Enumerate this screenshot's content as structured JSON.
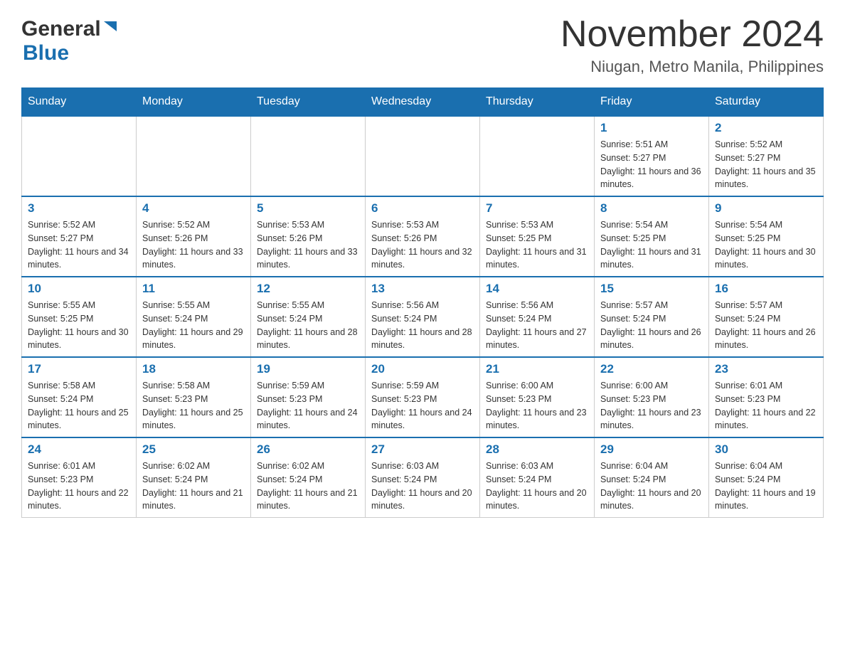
{
  "header": {
    "logo_general": "General",
    "logo_blue": "Blue",
    "month_title": "November 2024",
    "location": "Niugan, Metro Manila, Philippines"
  },
  "days_of_week": [
    "Sunday",
    "Monday",
    "Tuesday",
    "Wednesday",
    "Thursday",
    "Friday",
    "Saturday"
  ],
  "weeks": [
    {
      "days": [
        {
          "date": "",
          "info": ""
        },
        {
          "date": "",
          "info": ""
        },
        {
          "date": "",
          "info": ""
        },
        {
          "date": "",
          "info": ""
        },
        {
          "date": "",
          "info": ""
        },
        {
          "date": "1",
          "info": "Sunrise: 5:51 AM\nSunset: 5:27 PM\nDaylight: 11 hours and 36 minutes."
        },
        {
          "date": "2",
          "info": "Sunrise: 5:52 AM\nSunset: 5:27 PM\nDaylight: 11 hours and 35 minutes."
        }
      ]
    },
    {
      "days": [
        {
          "date": "3",
          "info": "Sunrise: 5:52 AM\nSunset: 5:27 PM\nDaylight: 11 hours and 34 minutes."
        },
        {
          "date": "4",
          "info": "Sunrise: 5:52 AM\nSunset: 5:26 PM\nDaylight: 11 hours and 33 minutes."
        },
        {
          "date": "5",
          "info": "Sunrise: 5:53 AM\nSunset: 5:26 PM\nDaylight: 11 hours and 33 minutes."
        },
        {
          "date": "6",
          "info": "Sunrise: 5:53 AM\nSunset: 5:26 PM\nDaylight: 11 hours and 32 minutes."
        },
        {
          "date": "7",
          "info": "Sunrise: 5:53 AM\nSunset: 5:25 PM\nDaylight: 11 hours and 31 minutes."
        },
        {
          "date": "8",
          "info": "Sunrise: 5:54 AM\nSunset: 5:25 PM\nDaylight: 11 hours and 31 minutes."
        },
        {
          "date": "9",
          "info": "Sunrise: 5:54 AM\nSunset: 5:25 PM\nDaylight: 11 hours and 30 minutes."
        }
      ]
    },
    {
      "days": [
        {
          "date": "10",
          "info": "Sunrise: 5:55 AM\nSunset: 5:25 PM\nDaylight: 11 hours and 30 minutes."
        },
        {
          "date": "11",
          "info": "Sunrise: 5:55 AM\nSunset: 5:24 PM\nDaylight: 11 hours and 29 minutes."
        },
        {
          "date": "12",
          "info": "Sunrise: 5:55 AM\nSunset: 5:24 PM\nDaylight: 11 hours and 28 minutes."
        },
        {
          "date": "13",
          "info": "Sunrise: 5:56 AM\nSunset: 5:24 PM\nDaylight: 11 hours and 28 minutes."
        },
        {
          "date": "14",
          "info": "Sunrise: 5:56 AM\nSunset: 5:24 PM\nDaylight: 11 hours and 27 minutes."
        },
        {
          "date": "15",
          "info": "Sunrise: 5:57 AM\nSunset: 5:24 PM\nDaylight: 11 hours and 26 minutes."
        },
        {
          "date": "16",
          "info": "Sunrise: 5:57 AM\nSunset: 5:24 PM\nDaylight: 11 hours and 26 minutes."
        }
      ]
    },
    {
      "days": [
        {
          "date": "17",
          "info": "Sunrise: 5:58 AM\nSunset: 5:24 PM\nDaylight: 11 hours and 25 minutes."
        },
        {
          "date": "18",
          "info": "Sunrise: 5:58 AM\nSunset: 5:23 PM\nDaylight: 11 hours and 25 minutes."
        },
        {
          "date": "19",
          "info": "Sunrise: 5:59 AM\nSunset: 5:23 PM\nDaylight: 11 hours and 24 minutes."
        },
        {
          "date": "20",
          "info": "Sunrise: 5:59 AM\nSunset: 5:23 PM\nDaylight: 11 hours and 24 minutes."
        },
        {
          "date": "21",
          "info": "Sunrise: 6:00 AM\nSunset: 5:23 PM\nDaylight: 11 hours and 23 minutes."
        },
        {
          "date": "22",
          "info": "Sunrise: 6:00 AM\nSunset: 5:23 PM\nDaylight: 11 hours and 23 minutes."
        },
        {
          "date": "23",
          "info": "Sunrise: 6:01 AM\nSunset: 5:23 PM\nDaylight: 11 hours and 22 minutes."
        }
      ]
    },
    {
      "days": [
        {
          "date": "24",
          "info": "Sunrise: 6:01 AM\nSunset: 5:23 PM\nDaylight: 11 hours and 22 minutes."
        },
        {
          "date": "25",
          "info": "Sunrise: 6:02 AM\nSunset: 5:24 PM\nDaylight: 11 hours and 21 minutes."
        },
        {
          "date": "26",
          "info": "Sunrise: 6:02 AM\nSunset: 5:24 PM\nDaylight: 11 hours and 21 minutes."
        },
        {
          "date": "27",
          "info": "Sunrise: 6:03 AM\nSunset: 5:24 PM\nDaylight: 11 hours and 20 minutes."
        },
        {
          "date": "28",
          "info": "Sunrise: 6:03 AM\nSunset: 5:24 PM\nDaylight: 11 hours and 20 minutes."
        },
        {
          "date": "29",
          "info": "Sunrise: 6:04 AM\nSunset: 5:24 PM\nDaylight: 11 hours and 20 minutes."
        },
        {
          "date": "30",
          "info": "Sunrise: 6:04 AM\nSunset: 5:24 PM\nDaylight: 11 hours and 19 minutes."
        }
      ]
    }
  ]
}
